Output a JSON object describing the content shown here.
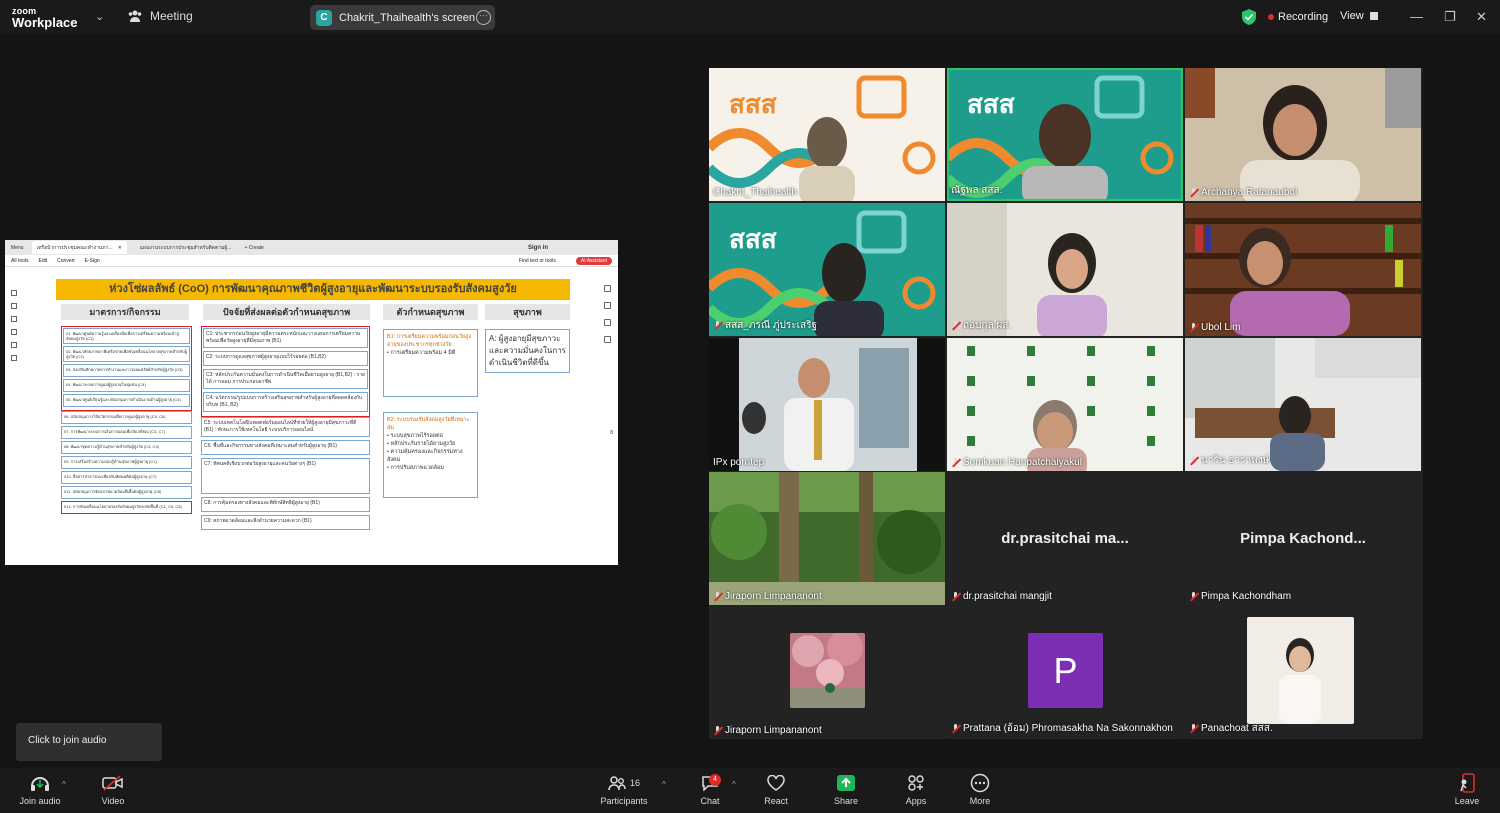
{
  "topbar": {
    "logo_line1": "zoom",
    "logo_line2": "Workplace",
    "meeting_label": "Meeting",
    "screen_badge": "C",
    "screen_label": "Chakrit_Thaihealth's screen",
    "recording_label": "Recording",
    "view_label": "View"
  },
  "share": {
    "tabs": [
      "Menu",
      "เทรียบ้าการประชุมคณะทำงานภา...",
      "แผนงานระบบการประชุมสำหรับติดตามผู้..."
    ],
    "new_tab": "+ Create",
    "signin": "Sign in",
    "toolbar": [
      "All tools",
      "Edit",
      "Convert",
      "E-Sign"
    ],
    "find": "Find text or tools",
    "ai": "AI Assistant",
    "title": "ห่วงโซ่ผลลัพธ์ (CoO) การพัฒนาคุณภาพชีวิตผู้สูงอายุและพัฒนาระบบรองรับสังคมสูงวัย",
    "col1_head": "มาตรการ/กิจกรรม",
    "col2_head": "ปัจจัยที่ส่งผลต่อตัวกำหนดสุขภาพ",
    "col3_head": "ตัวกำหนดสุขภาพ",
    "col4_head": "สุขภาพ",
    "col1_items": [
      "01. พัฒนาศูนย์ความรู้และเครื่องมือเพื่อการเตรียมความพร้อมเข้าสู่สังคมสูงวัย (C1)",
      "02. พัฒนาศักยภาพภาคีเครือข่ายเพื่อขับเคลื่อนนโยบายสุขภาพสำหรับผู้สูงวัย (C2)",
      "03. ส่งเสริมศักยภาพการทำงานและการออมทรัพย์สำหรับผู้สูงวัย (C3)",
      "04. พัฒนาระบบการดูแลผู้สูงอายุในชุมชน (C4)",
      "05. พัฒนาศูนย์เรียนรู้และสนับสนุนการดำเนินงานด้านผู้สูงอายุ (C4)",
      "06. สนับสนุนการใช้นวัตกรรมเพื่อการดูแลผู้สูงอายุ (C5, C6)",
      "07. การพัฒนาระบบการเงินการออมเพื่อวัยเกษียณ (C3, C7)",
      "08. พัฒนาชุดความรู้ด้านสุขภาพสำหรับผู้สูงวัย (C3, C4)",
      "09. การเสริมสร้างความรอบรู้ด้านสุขภาพผู้สูงอายุ (C1)",
      "010. สื่อสารสาธารณะเพื่อปรับทัศนคติต่อผู้สูงอายุ (C7)",
      "011. สนับสนุนการจัดสภาพแวดล้อมที่เอื้อต่อผู้สูงอายุ (C8)",
      "012. การขับเคลื่อนนโยบายรองรับสังคมสูงวัยระดับพื้นที่ (C1, C5, C6)"
    ],
    "col2_items": [
      "C1: ประชากรก่อนวัยสูงอายุมีความตระหนักและวางแผนการเตรียมความพร้อมเพื่อวัยสูงอายุที่มีคุณภาพ (B1)",
      "C2: ระบบการดูแลสุขภาพผู้สูงอายุแบบไร้รอยต่อ (B1,B2)",
      "C3: หลักประกันความมั่นคงในการดำเนินชีวิตเมื่อยามสูงอายุ (B1,B2) : รายได้ การออม การประกอบอาชีพ",
      "C4: นวัตกรรม/รูปแบบการสร้างเสริมสุขภาพสำหรับผู้สูงอายุที่สอดคล้องกับบริบท (B1, B2)",
      "C5: ระบบเทคโนโลยี/แพลตฟอร์มออนไลน์ที่ช่วยให้ผู้สูงอายุมีสุขภาวะที่ดี (B1) : ทักษะการใช้เทคโนโลยี ระบบบริการออนไลน์",
      "C6: พื้นที่และกิจกรรมทางสังคมที่เหมาะสมสำหรับผู้สูงอายุ (B1)",
      "C7: ทัศนคติเชิงบวกต่อวัยสูงอายุและคนวัยต่างๆ (B1)",
      "C8: การคุ้มครองทางสังคมและพิทักษ์สิทธิผู้สูงอายุ (B1)",
      "C9: สภาพแวดล้อมและสิ่งอำนวยความสะดวก (B1)"
    ],
    "col3_box1_title": "B1: การเตรียมความพร้อมก่อนวัยสูงอายุของประชากรทุกช่วงวัย",
    "col3_box1_bullet": "การเตรียมความพร้อม 4 มิติ",
    "col3_box2_title": "B2: ระบบรองรับสังคมสูงวัยที่เหมาะสม",
    "col3_box2_bullets": [
      "ระบบสุขภาพไร้รอยต่อ",
      "หลักประกันรายได้ยามสูงวัย",
      "ความคุ้มครองและกิจกรรมทางสังคม",
      "การปรับสภาพแวดล้อม"
    ],
    "col4_text": "A: ผู้สูงอายุมีสุขภาวะและความมั่นคงในการดำเนินชีวิตที่ดีขึ้น",
    "page_number": "8"
  },
  "participants": [
    {
      "name": "Chakrit_Thaihealth",
      "muted": false,
      "bg": "orange"
    },
    {
      "name": "ณัฐพล สสส.",
      "muted": false,
      "bg": "teal",
      "active": true
    },
    {
      "name": "Archanya Ratanaubol",
      "muted": true,
      "bg": "room"
    },
    {
      "name": "สสส_ภรณี ภู่ประเสริฐ",
      "muted": true,
      "bg": "teal"
    },
    {
      "name": "ถอบกุล ผส.",
      "muted": true,
      "bg": "office"
    },
    {
      "name": "Ubol Lim",
      "muted": true,
      "bg": "shelf"
    },
    {
      "name": "IPx porntep",
      "muted": false,
      "bg": "car"
    },
    {
      "name": "Somkuan Hanpatchaiyakul",
      "muted": true,
      "bg": "pattern"
    },
    {
      "name": "นาริน ธาราพงษ์",
      "muted": true,
      "bg": "office2"
    },
    {
      "name": "Jiraporn Limpananont",
      "muted": true,
      "bg": "garden"
    },
    {
      "name": "dr.prasitchai mangjit",
      "muted": true,
      "bg": "none",
      "big": "dr.prasitchai ma..."
    },
    {
      "name": "Pimpa Kachondham",
      "muted": true,
      "bg": "none",
      "big": "Pimpa Kachond..."
    },
    {
      "name": "Jiraporn Limpananont",
      "muted": true,
      "bg": "thumb-pink"
    },
    {
      "name": "Prattana (อ้อม) Phromasakha Na Sakonnakhon",
      "muted": true,
      "bg": "thumb-p",
      "letter": "P"
    },
    {
      "name": "Panachoat สสส.",
      "muted": true,
      "bg": "thumb-man"
    }
  ],
  "toast": {
    "text": "Click to join audio"
  },
  "bottombar": {
    "join_audio": "Join audio",
    "video": "Video",
    "participants": "Participants",
    "participants_count": "16",
    "chat": "Chat",
    "chat_badge": "4",
    "react": "React",
    "share": "Share",
    "apps": "Apps",
    "more": "More",
    "leave": "Leave"
  },
  "colors": {
    "accent_green": "#2ec46a",
    "record_red": "#e02b2b",
    "share_green": "#1fb65a",
    "teal_bg": "#1e9c8c",
    "orange_bg": "#f3a84a",
    "purple": "#7b2fb5"
  }
}
